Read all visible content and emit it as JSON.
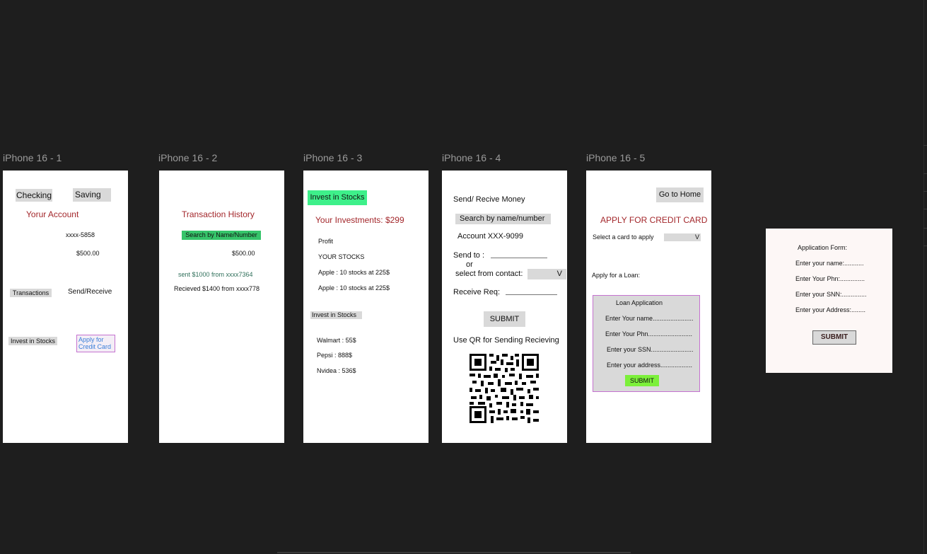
{
  "frames": {
    "f1": {
      "label": "iPhone 16 - 1",
      "checking": "Checking",
      "saving": "Saving",
      "account_title": "Yorur Account",
      "account_number": "xxxx-5858",
      "balance": "$500.00",
      "transactions": "Transactions",
      "send_receive": "Send/Receive",
      "invest": "Invest in Stocks",
      "apply_credit": "Apply for Credit Card"
    },
    "f2": {
      "label": "iPhone 16 - 2",
      "title": "Transaction History",
      "search": "Search by Name/Number",
      "balance": "$500.00",
      "sent": "sent $1000 from xxxx7364",
      "received": "Recieved $1400 from xxxx778"
    },
    "f3": {
      "label": "iPhone 16 - 3",
      "invest_header": "Invest in Stocks",
      "investments": "Your Investments: $299",
      "profit": "Profit",
      "your_stocks": "YOUR STOCKS",
      "stock_1": "Apple : 10 stocks at 225$",
      "stock_2": "Apple : 10 stocks at 225$",
      "invest_btn": "Invest in Stocks",
      "walmart": "Walmart : 55$",
      "pepsi": "Pepsi : 888$",
      "nvidea": "Nvidea : 536$"
    },
    "f4": {
      "label": "iPhone 16 - 4",
      "title": "Send/ Recive Money",
      "search": "Search by name/number",
      "account": "Account XXX-9099",
      "send_to": "Send to :",
      "or": "or",
      "select_contact": "select from contact:",
      "dropdown_value": "V",
      "receive_req": "Receive Req:",
      "submit": "SUBMIT",
      "qr_text": "Use QR for Sending Recieving"
    },
    "f5": {
      "label": "iPhone 16 - 5",
      "go_home": "Go to Home",
      "title": "APPLY FOR CREDIT CARD",
      "select_card": "Select a card to apply",
      "dropdown_value": "V",
      "apply_loan": "Apply for a Loan:",
      "loan_title": "Loan Application",
      "loan_name": "Enter Your name.......................",
      "loan_phn": "Enter Your Phn.........................",
      "loan_ssn": "Enter your SSN........................",
      "loan_address": "Enter your address..................",
      "loan_submit": "SUBMIT"
    },
    "form": {
      "title": "Application Form:",
      "name": "Enter your name:...........",
      "phn": "Enter Your Phn:..............",
      "ssn": "Enter your SNN:..............",
      "address": "Enter your Address:........",
      "submit": "SUBMIT"
    }
  },
  "colors": {
    "canvas": "#1e1e1e",
    "frame_label": "#9a9a9a",
    "accent_red": "#a3272b",
    "green_highlight": "#36c46a",
    "invest_green": "#3ef08a",
    "lime_submit": "#7cf03a",
    "purple_border": "#c572d0",
    "link_blue": "#3b7fd9",
    "teal_text": "#2f6f5a"
  }
}
